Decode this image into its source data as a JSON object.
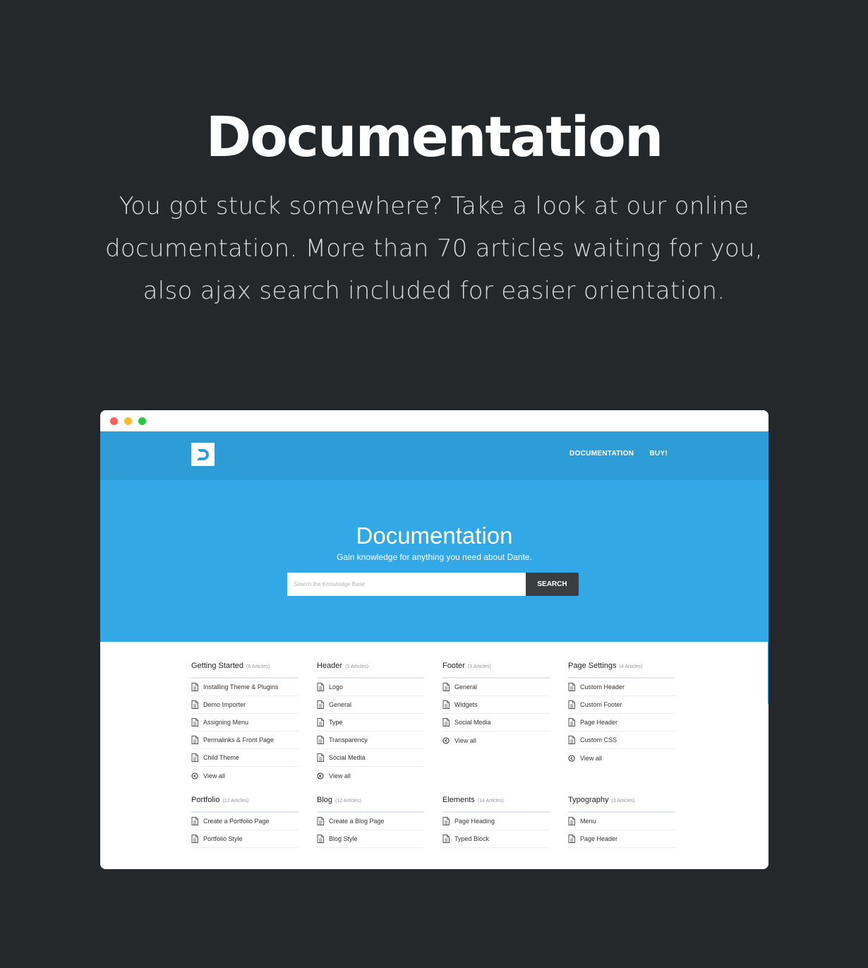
{
  "promo": {
    "title": "Documentation",
    "text": "You got stuck somewhere? Take a look at our online documentation. More than 70 articles waiting for you, also ajax search included for easier orientation."
  },
  "browser": {
    "traffic_lights": [
      "close",
      "minimize",
      "maximize"
    ],
    "nav": {
      "logo_icon": "d-logo-icon",
      "links": [
        {
          "label": "DOCUMENTATION"
        },
        {
          "label": "BUY!"
        }
      ]
    },
    "hero": {
      "title": "Documentation",
      "subtitle": "Gain knowledge for anything you need about Dante.",
      "search": {
        "placeholder": "Search the Knowledge Base",
        "value": "",
        "button_label": "SEARCH"
      }
    },
    "categories": [
      {
        "title": "Getting Started",
        "count": "(6 Articles)",
        "items": [
          "Installing Theme & Plugins",
          "Demo Importer",
          "Assigning Menu",
          "Permalinks & Front Page",
          "Child Theme"
        ],
        "view_all": "View all"
      },
      {
        "title": "Header",
        "count": "(5 Articles)",
        "items": [
          "Logo",
          "General",
          "Type",
          "Transparency",
          "Social Media"
        ],
        "view_all": "View all"
      },
      {
        "title": "Footer",
        "count": "(3 Articles)",
        "items": [
          "General",
          "Widgets",
          "Social Media"
        ],
        "view_all": "View all"
      },
      {
        "title": "Page Settings",
        "count": "(4 Articles)",
        "items": [
          "Custom Header",
          "Custom Footer",
          "Page Header",
          "Custom CSS"
        ],
        "view_all": "View all"
      },
      {
        "title": "Portfolio",
        "count": "(12 Articles)",
        "items": [
          "Create a Portfolio Page",
          "Portfolio Style"
        ],
        "view_all": null
      },
      {
        "title": "Blog",
        "count": "(12 Articles)",
        "items": [
          "Create a Blog Page",
          "Blog Style"
        ],
        "view_all": null
      },
      {
        "title": "Elements",
        "count": "(14 Articles)",
        "items": [
          "Page Heading",
          "Typed Block"
        ],
        "view_all": null
      },
      {
        "title": "Typography",
        "count": "(3 Articles)",
        "items": [
          "Menu",
          "Page Header"
        ],
        "view_all": null
      }
    ]
  },
  "colors": {
    "page_bg": "#25282b",
    "nav_bg": "#2d9cd7",
    "hero_bg": "#33a8e6",
    "search_button_bg": "#3b3d40"
  }
}
